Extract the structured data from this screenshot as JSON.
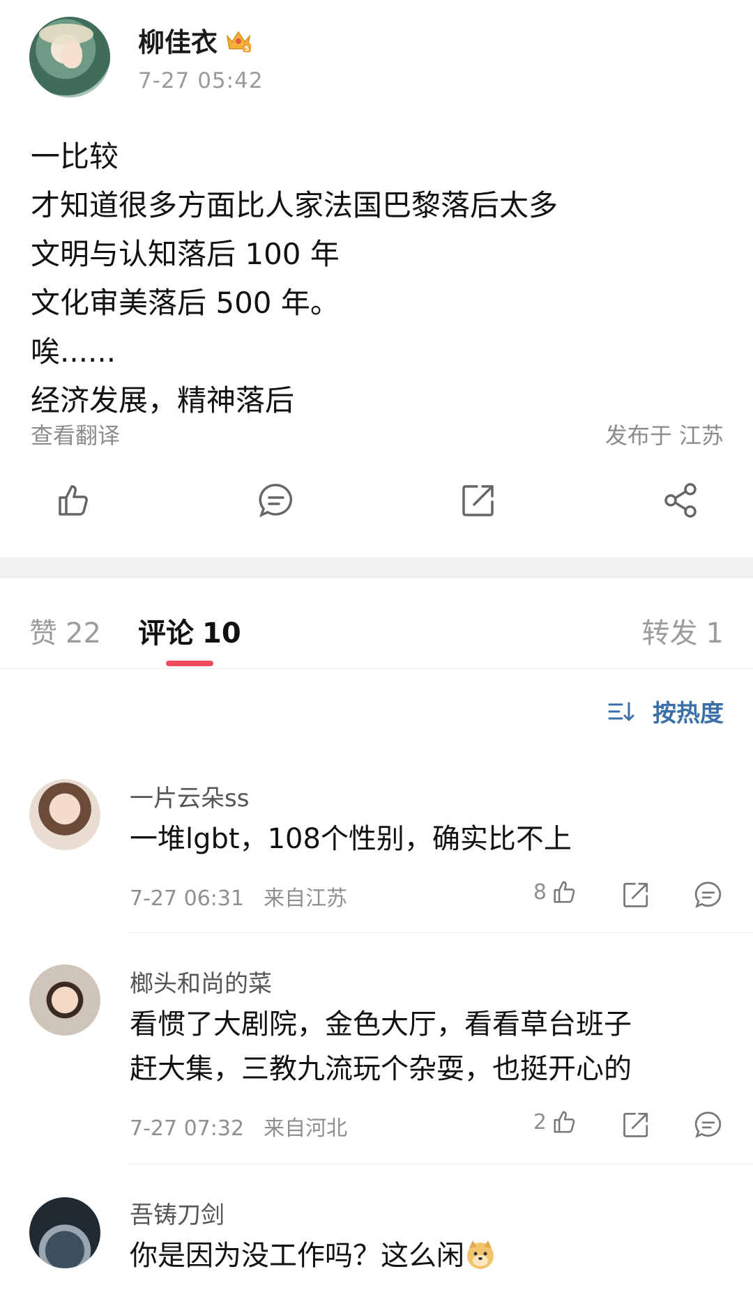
{
  "post": {
    "username": "柳佳衣",
    "time": "7-27 05:42",
    "lines": [
      "一比较",
      "才知道很多方面比人家法国巴黎落后太多",
      "文明与认知落后 100 年",
      "文化审美落后 500 年。",
      "唉......",
      "经济发展，精神落后"
    ],
    "view_translation": "查看翻译",
    "location": "发布于 江苏",
    "icons": {
      "badge": "crown-badge-icon",
      "like": "thumbs-up-icon",
      "comment": "comment-icon",
      "repost": "repost-icon",
      "share": "share-icon"
    }
  },
  "tabs": {
    "likes_label": "赞",
    "likes_count": "22",
    "comments_label": "评论",
    "comments_count": "10",
    "reposts_label": "转发",
    "reposts_count": "1"
  },
  "sort": {
    "label": "按热度",
    "icon": "sort-icon"
  },
  "comments": [
    {
      "name": "一片云朵ss",
      "text": "一堆lgbt，108个性别，确实比不上",
      "time": "7-27 06:31",
      "location": "来自江苏",
      "likes": "8"
    },
    {
      "name": "榔头和尚的菜",
      "text_lines": [
        "看惯了大剧院，金色大厅，看看草台班子",
        "赶大集，三教九流玩个杂耍，也挺开心的"
      ],
      "time": "7-27 07:32",
      "location": "来自河北",
      "likes": "2"
    },
    {
      "name": "吾铸刀剑",
      "text": "你是因为没工作吗？这么闲",
      "emoji": "doge-icon"
    }
  ],
  "colors": {
    "accent": "#ee4b5f",
    "link": "#3b6fa8",
    "muted": "#8f8f8f"
  }
}
